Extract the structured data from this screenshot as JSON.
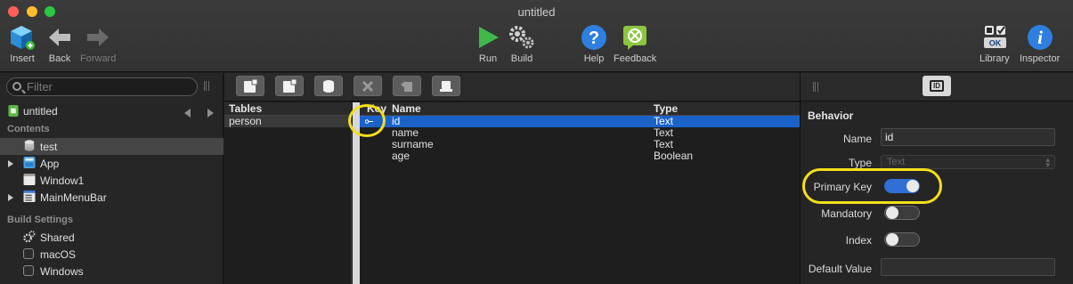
{
  "window": {
    "title": "untitled"
  },
  "toolbar": {
    "insert": "Insert",
    "back": "Back",
    "forward": "Forward",
    "run": "Run",
    "build": "Build",
    "help": "Help",
    "feedback": "Feedback",
    "library": "Library",
    "library_badge": "OK",
    "inspector": "Inspector"
  },
  "sidebar": {
    "filter_placeholder": "Filter",
    "project_name": "untitled",
    "contents_header": "Contents",
    "contents": [
      {
        "label": "test",
        "icon": "database-icon",
        "selected": true
      },
      {
        "label": "App",
        "icon": "app-icon",
        "expandable": true
      },
      {
        "label": "Window1",
        "icon": "window-icon"
      },
      {
        "label": "MainMenuBar",
        "icon": "menubar-icon",
        "expandable": true
      }
    ],
    "build_settings_header": "Build Settings",
    "build_settings": [
      {
        "label": "Shared",
        "icon": "gears-icon"
      },
      {
        "label": "macOS",
        "icon": "checkbox"
      },
      {
        "label": "Windows",
        "icon": "checkbox"
      }
    ]
  },
  "editor": {
    "tables_header": "Tables",
    "tables": [
      "person"
    ],
    "fields_headers": {
      "key": "Key",
      "name": "Name",
      "type": "Type"
    },
    "fields": [
      {
        "name": "id",
        "type": "Text",
        "key": true,
        "selected": true
      },
      {
        "name": "name",
        "type": "Text"
      },
      {
        "name": "surname",
        "type": "Text"
      },
      {
        "name": "age",
        "type": "Boolean"
      }
    ]
  },
  "inspector": {
    "id_button": "ID",
    "section": "Behavior",
    "name_label": "Name",
    "name_value": "id",
    "type_label": "Type",
    "type_value": "Text",
    "primary_key_label": "Primary Key",
    "primary_key_on": true,
    "mandatory_label": "Mandatory",
    "mandatory_on": false,
    "index_label": "Index",
    "index_on": false,
    "default_value_label": "Default Value",
    "default_value": ""
  },
  "colors": {
    "selection": "#1a62c8",
    "highlight_ring": "#f3df1b",
    "toggle_on": "#2f6fd6"
  }
}
